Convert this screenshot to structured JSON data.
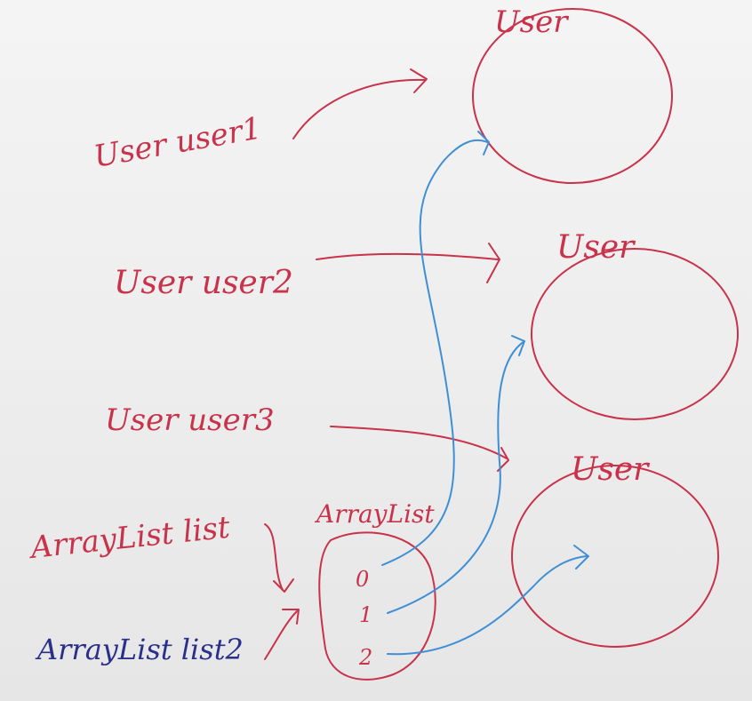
{
  "labels": {
    "object_title_1": "User",
    "object_title_2": "User",
    "object_title_3": "User",
    "var_user1": "User user1",
    "var_user2": "User user2",
    "var_user3": "User user3",
    "var_list": "ArrayList list",
    "var_list2": "ArrayList list2",
    "array_object_title": "ArrayList",
    "index_0": "0",
    "index_1": "1",
    "index_2": "2"
  },
  "colors": {
    "red_ink": "#c8324a",
    "blue_ink": "#3f8fd6",
    "navy_ink": "#2a2f8a",
    "board": "#f0f0f0"
  }
}
